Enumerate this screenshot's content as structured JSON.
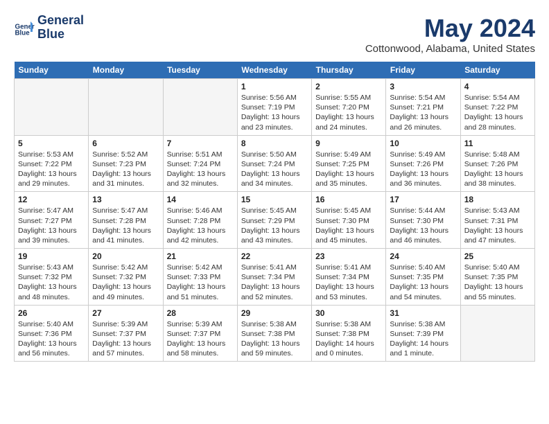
{
  "header": {
    "logo_line1": "General",
    "logo_line2": "Blue",
    "month": "May 2024",
    "location": "Cottonwood, Alabama, United States"
  },
  "days_of_week": [
    "Sunday",
    "Monday",
    "Tuesday",
    "Wednesday",
    "Thursday",
    "Friday",
    "Saturday"
  ],
  "weeks": [
    [
      {
        "day": "",
        "empty": true
      },
      {
        "day": "",
        "empty": true
      },
      {
        "day": "",
        "empty": true
      },
      {
        "day": "1",
        "rise": "5:56 AM",
        "set": "7:19 PM",
        "daylight": "13 hours and 23 minutes."
      },
      {
        "day": "2",
        "rise": "5:55 AM",
        "set": "7:20 PM",
        "daylight": "13 hours and 24 minutes."
      },
      {
        "day": "3",
        "rise": "5:54 AM",
        "set": "7:21 PM",
        "daylight": "13 hours and 26 minutes."
      },
      {
        "day": "4",
        "rise": "5:54 AM",
        "set": "7:22 PM",
        "daylight": "13 hours and 28 minutes."
      }
    ],
    [
      {
        "day": "5",
        "rise": "5:53 AM",
        "set": "7:22 PM",
        "daylight": "13 hours and 29 minutes."
      },
      {
        "day": "6",
        "rise": "5:52 AM",
        "set": "7:23 PM",
        "daylight": "13 hours and 31 minutes."
      },
      {
        "day": "7",
        "rise": "5:51 AM",
        "set": "7:24 PM",
        "daylight": "13 hours and 32 minutes."
      },
      {
        "day": "8",
        "rise": "5:50 AM",
        "set": "7:24 PM",
        "daylight": "13 hours and 34 minutes."
      },
      {
        "day": "9",
        "rise": "5:49 AM",
        "set": "7:25 PM",
        "daylight": "13 hours and 35 minutes."
      },
      {
        "day": "10",
        "rise": "5:49 AM",
        "set": "7:26 PM",
        "daylight": "13 hours and 36 minutes."
      },
      {
        "day": "11",
        "rise": "5:48 AM",
        "set": "7:26 PM",
        "daylight": "13 hours and 38 minutes."
      }
    ],
    [
      {
        "day": "12",
        "rise": "5:47 AM",
        "set": "7:27 PM",
        "daylight": "13 hours and 39 minutes."
      },
      {
        "day": "13",
        "rise": "5:47 AM",
        "set": "7:28 PM",
        "daylight": "13 hours and 41 minutes."
      },
      {
        "day": "14",
        "rise": "5:46 AM",
        "set": "7:28 PM",
        "daylight": "13 hours and 42 minutes."
      },
      {
        "day": "15",
        "rise": "5:45 AM",
        "set": "7:29 PM",
        "daylight": "13 hours and 43 minutes."
      },
      {
        "day": "16",
        "rise": "5:45 AM",
        "set": "7:30 PM",
        "daylight": "13 hours and 45 minutes."
      },
      {
        "day": "17",
        "rise": "5:44 AM",
        "set": "7:30 PM",
        "daylight": "13 hours and 46 minutes."
      },
      {
        "day": "18",
        "rise": "5:43 AM",
        "set": "7:31 PM",
        "daylight": "13 hours and 47 minutes."
      }
    ],
    [
      {
        "day": "19",
        "rise": "5:43 AM",
        "set": "7:32 PM",
        "daylight": "13 hours and 48 minutes."
      },
      {
        "day": "20",
        "rise": "5:42 AM",
        "set": "7:32 PM",
        "daylight": "13 hours and 49 minutes."
      },
      {
        "day": "21",
        "rise": "5:42 AM",
        "set": "7:33 PM",
        "daylight": "13 hours and 51 minutes."
      },
      {
        "day": "22",
        "rise": "5:41 AM",
        "set": "7:34 PM",
        "daylight": "13 hours and 52 minutes."
      },
      {
        "day": "23",
        "rise": "5:41 AM",
        "set": "7:34 PM",
        "daylight": "13 hours and 53 minutes."
      },
      {
        "day": "24",
        "rise": "5:40 AM",
        "set": "7:35 PM",
        "daylight": "13 hours and 54 minutes."
      },
      {
        "day": "25",
        "rise": "5:40 AM",
        "set": "7:35 PM",
        "daylight": "13 hours and 55 minutes."
      }
    ],
    [
      {
        "day": "26",
        "rise": "5:40 AM",
        "set": "7:36 PM",
        "daylight": "13 hours and 56 minutes."
      },
      {
        "day": "27",
        "rise": "5:39 AM",
        "set": "7:37 PM",
        "daylight": "13 hours and 57 minutes."
      },
      {
        "day": "28",
        "rise": "5:39 AM",
        "set": "7:37 PM",
        "daylight": "13 hours and 58 minutes."
      },
      {
        "day": "29",
        "rise": "5:38 AM",
        "set": "7:38 PM",
        "daylight": "13 hours and 59 minutes."
      },
      {
        "day": "30",
        "rise": "5:38 AM",
        "set": "7:38 PM",
        "daylight": "14 hours and 0 minutes."
      },
      {
        "day": "31",
        "rise": "5:38 AM",
        "set": "7:39 PM",
        "daylight": "14 hours and 1 minute."
      },
      {
        "day": "",
        "empty": true
      }
    ]
  ]
}
